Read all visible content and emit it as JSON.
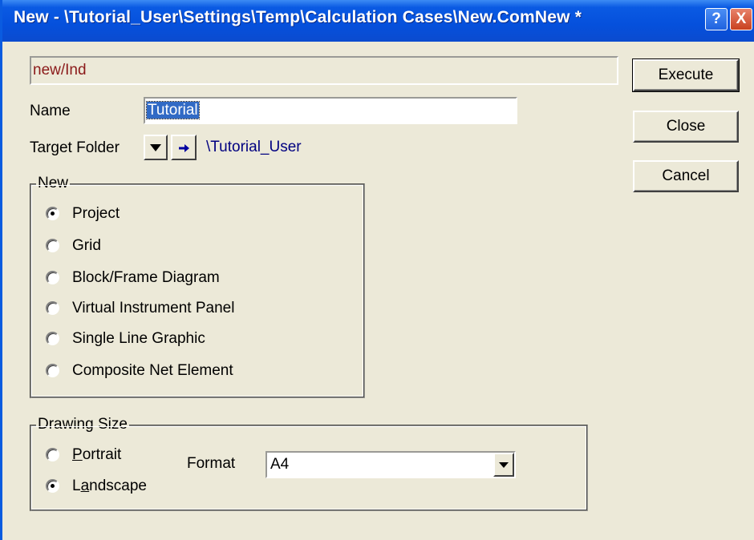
{
  "window": {
    "title": "New - \\Tutorial_User\\Settings\\Temp\\Calculation Cases\\New.ComNew *",
    "help_label": "?",
    "close_label": "X"
  },
  "path_display": "new/Ind",
  "buttons": {
    "execute": "Execute",
    "close": "Close",
    "cancel": "Cancel"
  },
  "name": {
    "label": "Name",
    "value": "Tutorial"
  },
  "target_folder": {
    "label": "Target Folder",
    "value": "\\Tutorial_User"
  },
  "new_group": {
    "legend": "New",
    "selected": "Project",
    "options": [
      "Project",
      "Grid",
      "Block/Frame Diagram",
      "Virtual Instrument Panel",
      "Single Line Graphic",
      "Composite Net Element"
    ]
  },
  "drawing_size": {
    "legend": "Drawing Size",
    "portrait": {
      "first": "P",
      "rest": "ortrait"
    },
    "landscape": {
      "first": "L",
      "underlined": "a",
      "rest": "ndscape"
    },
    "selected": "Landscape",
    "format_label": "Format",
    "format_value": "A4"
  },
  "colors": {
    "titlebar": "#0550dc",
    "dialog_bg": "#ece9d8",
    "path_text": "#8b1a1a",
    "folder_link": "#000080",
    "selection": "#316ac5"
  }
}
